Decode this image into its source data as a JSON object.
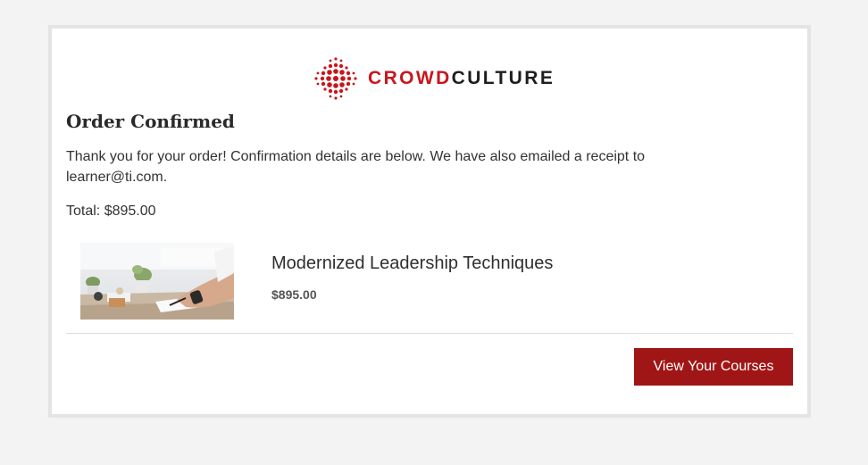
{
  "brand": {
    "logo_icon": "burst-dots-logo-icon",
    "name_part1": "CROWD",
    "name_part2": "CULTURE",
    "accent_color": "#c8161d"
  },
  "order": {
    "title": "Order Confirmed",
    "message": "Thank you for your order! Confirmation details are below. We have also emailed a receipt to learner@ti.com.",
    "total": "Total: $895.00"
  },
  "items": [
    {
      "title": "Modernized Leadership Techniques",
      "price": "$895.00",
      "thumbnail": "course-thumbnail-image"
    }
  ],
  "actions": {
    "view_courses_label": "View Your Courses",
    "button_color": "#a01616"
  }
}
